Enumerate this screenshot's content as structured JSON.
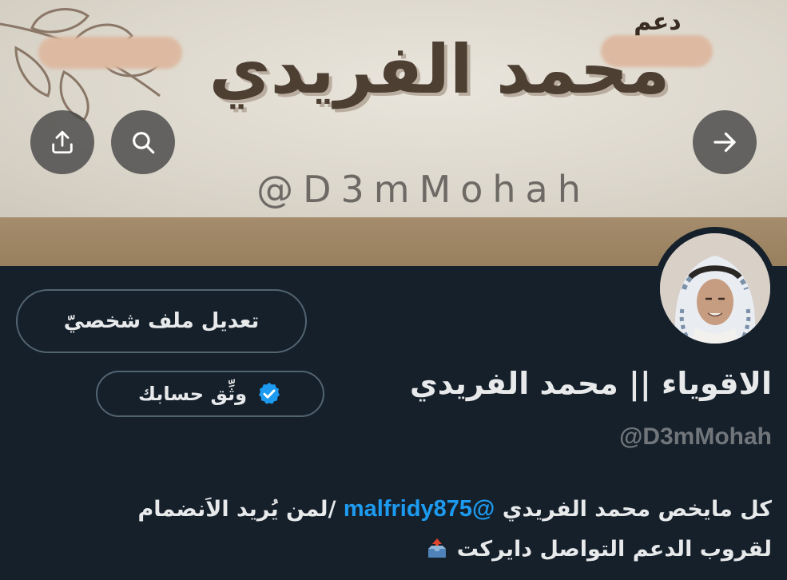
{
  "banner": {
    "small_text": "دعم",
    "name_text": "محمد الفريدي",
    "handle_text": "@D3mMohah",
    "colors": {
      "paper": "#e5e1d8",
      "stripe": "#a48c6c",
      "ink": "#4e3f33"
    }
  },
  "header_buttons": {
    "share_icon": "share-upload-icon",
    "search_icon": "search-icon",
    "forward_icon": "arrow-right-icon"
  },
  "profile": {
    "edit_button_label": "تعديل ملف شخصيّ",
    "display_name": "الاقوياء || محمد الفريدي",
    "verify_label": "وثِّق حسابك",
    "verify_icon": "verified-badge-icon",
    "handle": "@D3mMohah",
    "bio": {
      "line1_before": "كل مايخص محمد الفريدي",
      "mention": "@malfridy875",
      "line1_after": "/لمن يُريد الاَنضمام",
      "line2": "لقروب الدعم التواصل دايركت",
      "line2_icon": "inbox-tray-icon"
    }
  },
  "colors": {
    "background": "#15202b",
    "text": "#e7e9ea",
    "muted": "#71767b",
    "link": "#1d9bf0",
    "border": "#536471",
    "verified": "#1d9bf0"
  }
}
